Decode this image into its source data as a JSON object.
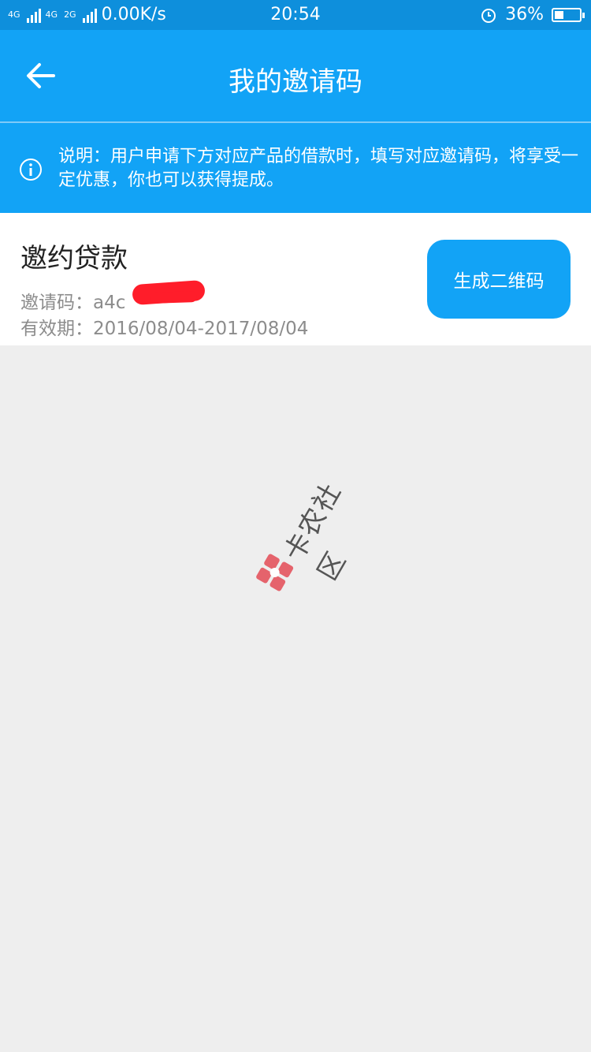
{
  "status_bar": {
    "network_1": "4G",
    "network_2": "4G",
    "network_3": "2G",
    "speed": "0.00K/s",
    "time": "20:54",
    "battery_percent": "36%",
    "battery_level": 0.36,
    "alarm_icon": "alarm-clock-icon"
  },
  "header": {
    "title": "我的邀请码",
    "back_icon": "arrow-left-icon"
  },
  "notice": {
    "icon": "info-icon",
    "text": "说明：用户申请下方对应产品的借款时，填写对应邀请码，将享受一定优惠，你也可以获得提成。"
  },
  "card": {
    "product_name": "邀约贷款",
    "code_label": "邀请码：",
    "code_value": "a4c",
    "valid_label": "有效期：",
    "valid_value": "2016/08/04-2017/08/04",
    "button_label": "生成二维码"
  },
  "watermark": {
    "text": "卡农社区"
  },
  "colors": {
    "primary": "#12a3f6",
    "statusbar": "#0e8fdc",
    "background": "#eeeeee",
    "redaction": "#ff1d2a"
  }
}
